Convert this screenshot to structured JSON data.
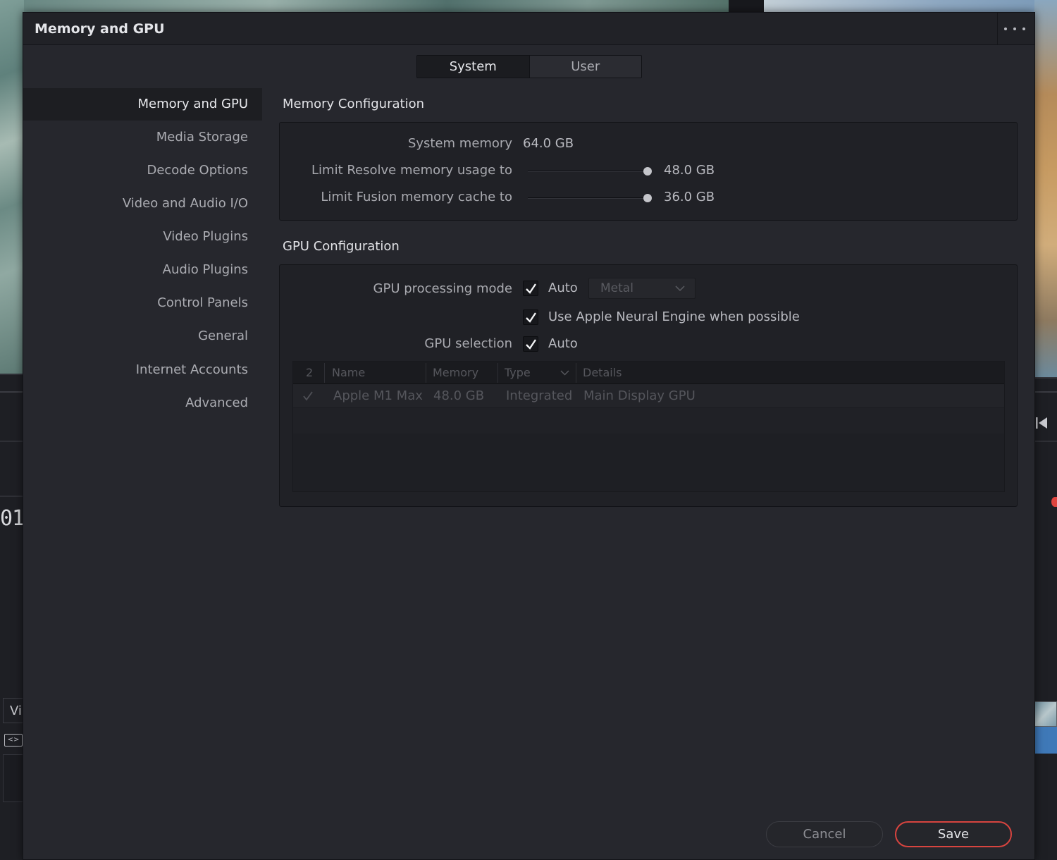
{
  "dialog": {
    "title": "Memory and GPU"
  },
  "tabs": [
    {
      "label": "System",
      "active": true
    },
    {
      "label": "User",
      "active": false
    }
  ],
  "sidebar": {
    "items": [
      {
        "label": "Memory and GPU",
        "active": true
      },
      {
        "label": "Media Storage"
      },
      {
        "label": "Decode Options"
      },
      {
        "label": "Video and Audio I/O"
      },
      {
        "label": "Video Plugins"
      },
      {
        "label": "Audio Plugins"
      },
      {
        "label": "Control Panels"
      },
      {
        "label": "General"
      },
      {
        "label": "Internet Accounts"
      },
      {
        "label": "Advanced"
      }
    ]
  },
  "memory": {
    "title": "Memory Configuration",
    "system_memory_label": "System memory",
    "system_memory_value": "64.0 GB",
    "resolve_limit_label": "Limit Resolve memory usage to",
    "resolve_limit_value": "48.0 GB",
    "resolve_limit_fraction": 1.0,
    "fusion_cache_label": "Limit Fusion memory cache to",
    "fusion_cache_value": "36.0 GB",
    "fusion_cache_fraction": 1.0
  },
  "gpu": {
    "title": "GPU Configuration",
    "processing_mode_label": "GPU processing mode",
    "processing_auto_checked": true,
    "processing_auto_label": "Auto",
    "processing_mode_select": "Metal",
    "neural_engine_checked": true,
    "neural_engine_label": "Use Apple Neural Engine when possible",
    "selection_label": "GPU selection",
    "selection_auto_checked": true,
    "selection_auto_label": "Auto",
    "table": {
      "headers": {
        "count": "2",
        "name": "Name",
        "memory": "Memory",
        "type": "Type",
        "details": "Details"
      },
      "rows": [
        {
          "checked": true,
          "name": "Apple M1 Max",
          "memory": "48.0 GB",
          "type": "Integrated",
          "details": "Main Display GPU"
        }
      ]
    }
  },
  "footer": {
    "cancel_label": "Cancel",
    "save_label": "Save"
  },
  "background": {
    "timecode_fragment": "01",
    "track_label_fragment": "Vi"
  },
  "colors": {
    "accent_save_border": "#d8443f",
    "dialog_bg": "#26272d"
  }
}
